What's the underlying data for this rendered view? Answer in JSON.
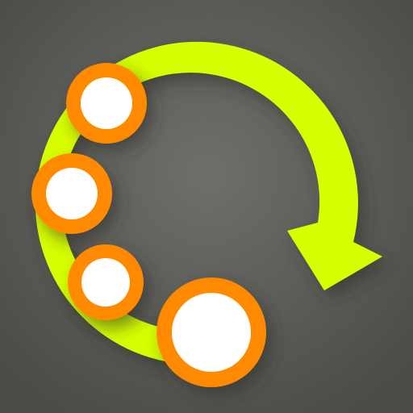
{
  "icon": {
    "semantic_name": "circular-arrow-with-nodes-icon",
    "colors": {
      "background_center": "#6f6f6a",
      "background_edge": "#4a4a47",
      "arrow": "#d7ff00",
      "arrow_shadow": "#2e2e2b",
      "node_ring": "#ff8a00",
      "node_fill": "#ffffff"
    },
    "nodes": [
      {
        "name": "node-top",
        "size": "medium"
      },
      {
        "name": "node-middle",
        "size": "medium"
      },
      {
        "name": "node-lower",
        "size": "small"
      },
      {
        "name": "node-bottom",
        "size": "large"
      }
    ]
  }
}
